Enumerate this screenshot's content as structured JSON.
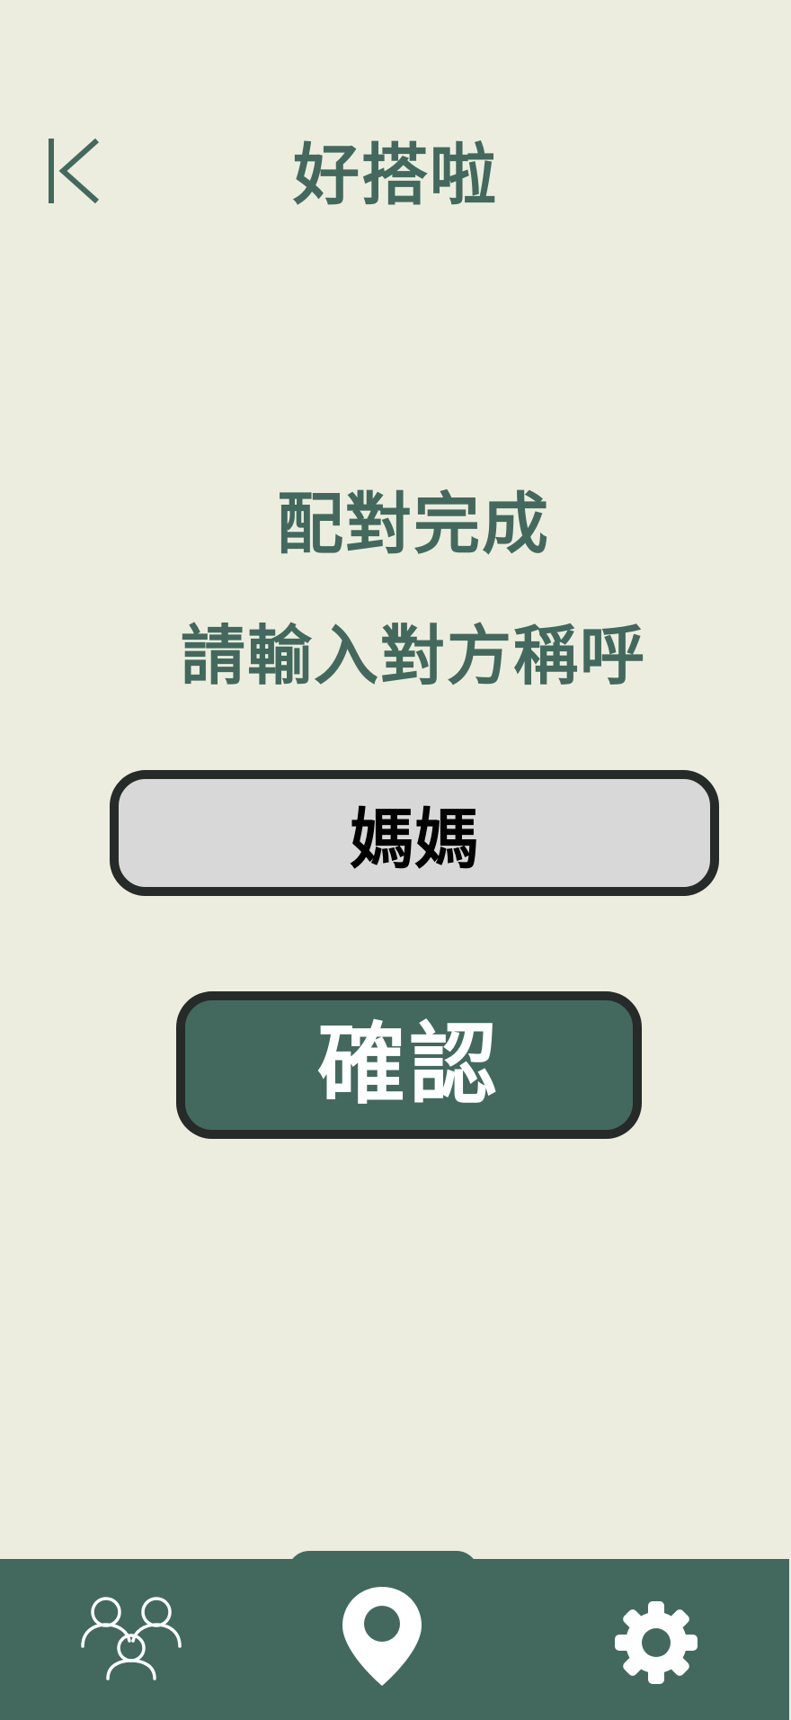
{
  "header": {
    "back_icon": "back-icon",
    "title": "好搭啦"
  },
  "main": {
    "status_text": "配對完成",
    "prompt_text": "請輸入對方稱呼",
    "nickname_input_value": "媽媽",
    "confirm_label": "確認"
  },
  "bottom_nav": {
    "items": [
      {
        "icon": "people-icon"
      },
      {
        "icon": "location-pin-icon"
      },
      {
        "icon": "gear-icon"
      }
    ]
  },
  "colors": {
    "background": "#EDEDDF",
    "primary": "#43695E",
    "border": "#262A28",
    "input_bg": "#D8D8D8"
  }
}
